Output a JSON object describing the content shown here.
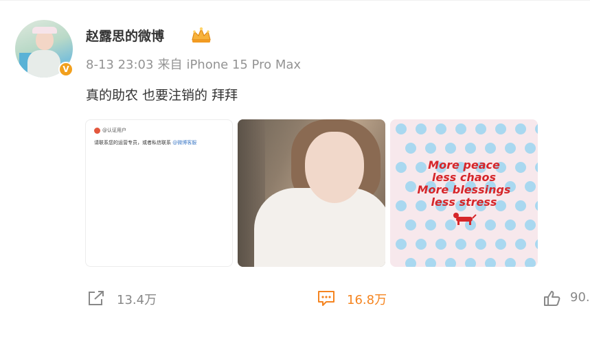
{
  "post": {
    "username": "赵露思的微博",
    "timestamp": "8-13 23:03",
    "source_prefix": "来自",
    "source_device": "iPhone 15 Pro Max",
    "text": "真的助农 也要注销的 拜拜",
    "verified_badge": "V"
  },
  "images": [
    {
      "type": "screenshot",
      "header": "@认证用户",
      "body_text": "请联系您的运营专员，或者私信联系",
      "body_link": "@微博客服"
    },
    {
      "type": "selfie-photo"
    },
    {
      "type": "quote-graphic",
      "lines": [
        "More peace",
        "less chaos",
        "More blessings",
        "less stress"
      ],
      "accent_color": "#d6262a",
      "dot_color": "#a9d8f0"
    }
  ],
  "actions": {
    "share": {
      "icon": "share-icon",
      "count": "13.4万"
    },
    "comment": {
      "icon": "comment-icon",
      "count": "16.8万",
      "color": "#f5841f"
    },
    "like": {
      "icon": "thumbs-up-icon",
      "count": "90."
    }
  }
}
